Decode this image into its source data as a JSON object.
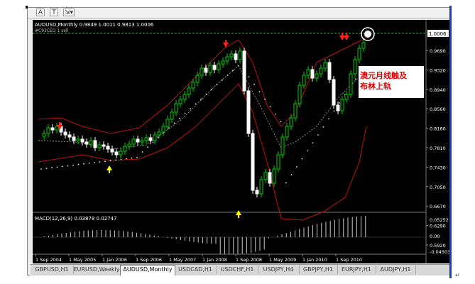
{
  "toolbar": {
    "btn1": "A",
    "btn2": "T",
    "btn3": "⇲▾"
  },
  "chart": {
    "symbol_header": "AUDUSD,Monthly  0.9849 1.0011 0.9813 1.0006",
    "sub_header": "#C93CED 1 sell",
    "last_price": "1.0006",
    "price_ticks": [
      "0.9690",
      "0.9320",
      "0.8940",
      "0.8560",
      "0.8180",
      "0.7810",
      "0.7430",
      "0.7050",
      "0.6670",
      "0.6290",
      "0.5920"
    ],
    "macd_label": "MACD(12,26,9) 0.03878 0.02747",
    "macd_ticks": [
      "0.05252",
      "0.00",
      "-0.04503"
    ],
    "date_ticks": [
      "1 Sep 2004",
      "1 May 2005",
      "1 Jan 2006",
      "1 Sep 2006",
      "1 May 2007",
      "1 Jan 2008",
      "1 Sep 2008",
      "1 May 2009",
      "1 Jan 2010",
      "1 Sep 2010"
    ],
    "annotation_line1": "澳元月线触及",
    "annotation_line2": "布林上轨",
    "colors": {
      "bull": "#00d000",
      "bear": "#ffffff",
      "band": "#c01010",
      "mid": "#8a8a8a",
      "sar": "#e0e0e0",
      "arrow_down": "#ff2020",
      "arrow_up": "#ffff00",
      "annotation": "#e00000"
    }
  },
  "tabs": [
    {
      "label": "GBPUSD,H1"
    },
    {
      "label": "EURUSD,Weekly"
    },
    {
      "label": "AUDUSD,Monthly",
      "active": true
    },
    {
      "label": "USDCAD,H1"
    },
    {
      "label": "USDCHF,H1"
    },
    {
      "label": "USDJPY,H4"
    },
    {
      "label": "GBPJPY,H1"
    },
    {
      "label": "EURJPY,H1"
    },
    {
      "label": "AUDJPY,H1"
    }
  ]
}
